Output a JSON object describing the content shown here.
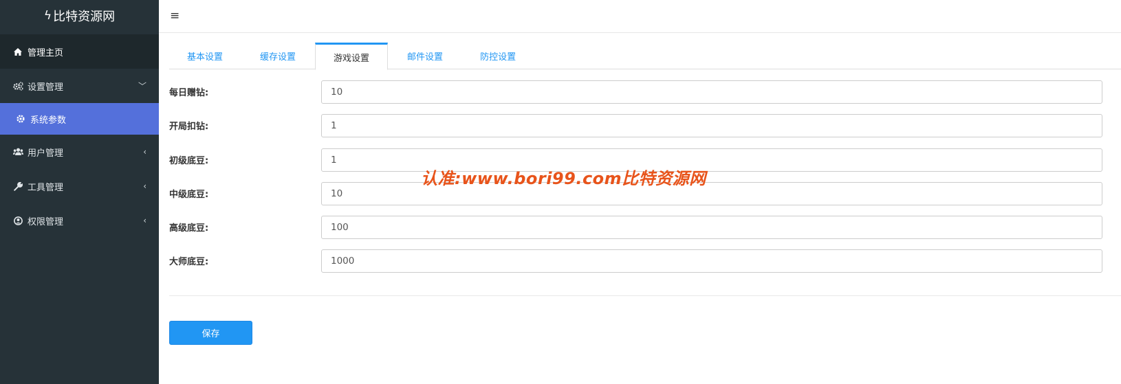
{
  "sidebar": {
    "brand": "比特资源网",
    "items": [
      {
        "label": "管理主页",
        "icon": "home-icon"
      },
      {
        "label": "设置管理",
        "icon": "gears-icon"
      },
      {
        "label": "系统参数",
        "icon": "gear-icon"
      },
      {
        "label": "用户管理",
        "icon": "users-icon"
      },
      {
        "label": "工具管理",
        "icon": "wrench-icon"
      },
      {
        "label": "权限管理",
        "icon": "user-circle-icon"
      }
    ]
  },
  "tabs": [
    {
      "label": "基本设置"
    },
    {
      "label": "缓存设置"
    },
    {
      "label": "游戏设置",
      "active": true
    },
    {
      "label": "邮件设置"
    },
    {
      "label": "防控设置"
    }
  ],
  "form": {
    "fields": [
      {
        "label": "每日赠钻:",
        "value": "10"
      },
      {
        "label": "开局扣钻:",
        "value": "1"
      },
      {
        "label": "初级底豆:",
        "value": "1"
      },
      {
        "label": "中级底豆:",
        "value": "10"
      },
      {
        "label": "高级底豆:",
        "value": "100"
      },
      {
        "label": "大师底豆:",
        "value": "1000"
      }
    ],
    "save_label": "保存"
  },
  "watermark": "认准:www.bori99.com比特资源网",
  "colors": {
    "sidebar_bg": "#263238",
    "active_menu": "#5470db",
    "accent": "#2196f3",
    "watermark": "#e8541b"
  }
}
